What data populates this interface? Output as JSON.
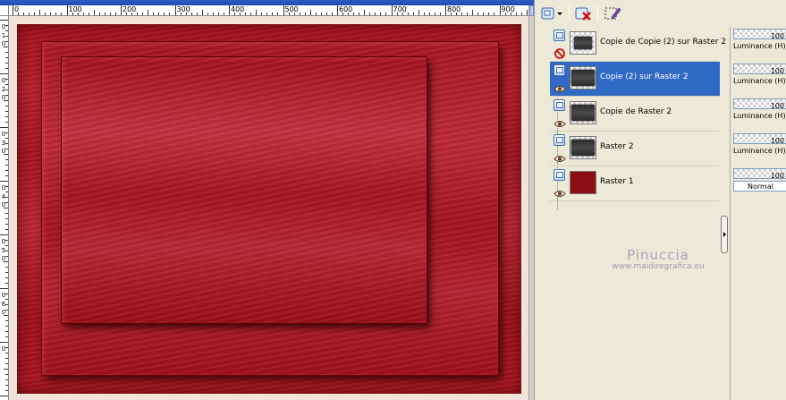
{
  "ruler": {
    "h_labels": [
      "0",
      "100",
      "200",
      "300",
      "400",
      "500",
      "600",
      "700",
      "800",
      "900"
    ],
    "v_labels": [
      "0",
      "1",
      "0",
      "0",
      "2",
      "0",
      "0",
      "3",
      "0",
      "0",
      "4",
      "0",
      "0",
      "5",
      "0",
      "0",
      "6",
      "0",
      "0"
    ]
  },
  "layers": [
    {
      "name": "Copie de Copie (2) sur Raster 2",
      "visible": false,
      "selected": false,
      "thumb": "dark",
      "opacity": "100",
      "blend": "Luminance (H)"
    },
    {
      "name": "Copie (2) sur Raster 2",
      "visible": true,
      "selected": true,
      "thumb": "dark-full",
      "opacity": "100",
      "blend": "Luminance (H)"
    },
    {
      "name": "Copie de Raster 2",
      "visible": true,
      "selected": false,
      "thumb": "dark-full",
      "opacity": "100",
      "blend": "Luminance (H)"
    },
    {
      "name": "Raster 2",
      "visible": true,
      "selected": false,
      "thumb": "dark-full",
      "opacity": "100",
      "blend": "Luminance (H)"
    },
    {
      "name": "Raster 1",
      "visible": true,
      "selected": false,
      "thumb": "red",
      "opacity": "100",
      "blend": "Normal"
    }
  ],
  "watermark": {
    "name": "Pinuccia",
    "url": "www.maidiregrafica.eu"
  },
  "colors": {
    "selection": "#316ac5",
    "canvas_red": "#a8151f",
    "panel_bg": "#ece9d8"
  },
  "icons": {
    "new_layer": "new-layer-icon",
    "delete_layer": "delete-layer-icon",
    "edit_selection": "edit-selection-icon",
    "visible": "eye-icon",
    "hidden": "hidden-icon"
  }
}
